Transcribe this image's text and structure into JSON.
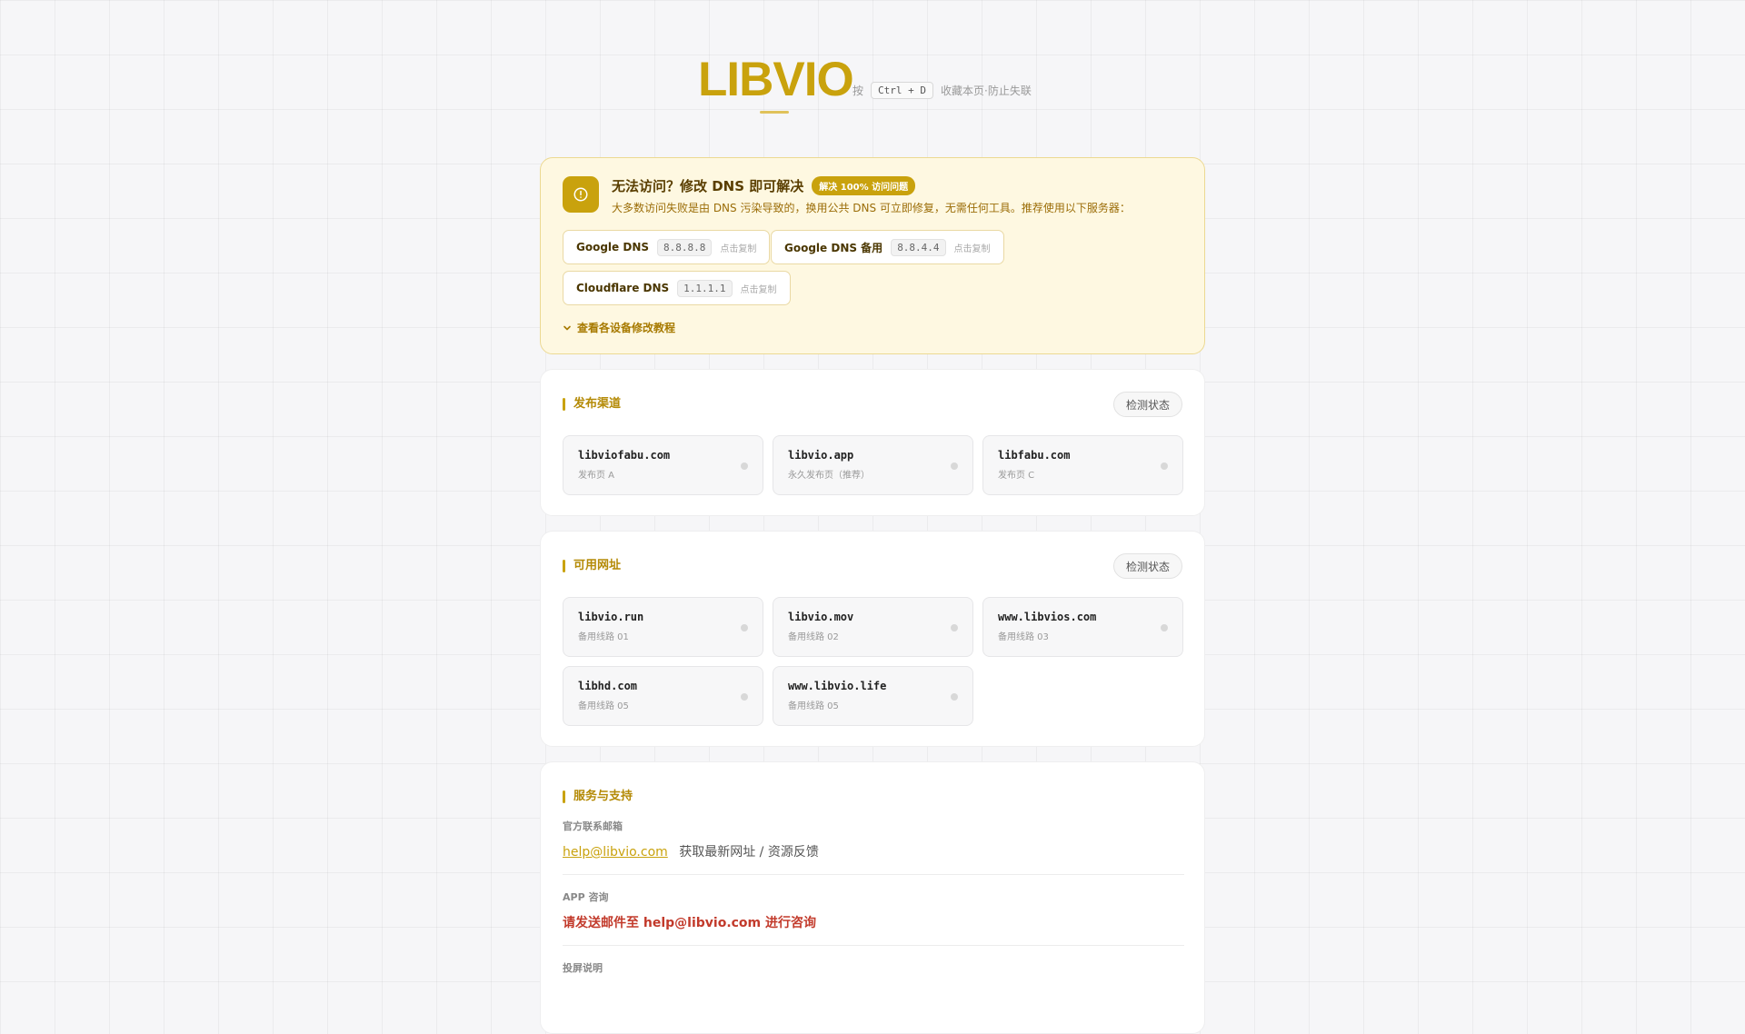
{
  "header": {
    "logo": "LIBVIO",
    "hint_prefix": "按",
    "shortcut": "Ctrl + D",
    "hint_suffix": "收藏本页·防止失联"
  },
  "dns": {
    "title": "无法访问？修改 DNS 即可解决",
    "badge": "解决 100% 访问问题",
    "description": "大多数访问失败是由 DNS 污染导致的，换用公共 DNS 可立即修复，无需任何工具。推荐使用以下服务器：",
    "copy_label": "点击复制",
    "servers": [
      {
        "name": "Google DNS",
        "ip": "8.8.8.8"
      },
      {
        "name": "Google DNS 备用",
        "ip": "8.8.4.4"
      },
      {
        "name": "Cloudflare DNS",
        "ip": "1.1.1.1"
      }
    ],
    "tutorial": "查看各设备修改教程",
    "icon": "alert-circle-icon"
  },
  "release": {
    "title": "发布渠道",
    "check_label": "检测状态",
    "items": [
      {
        "domain": "libviofabu.com",
        "desc": "发布页 A"
      },
      {
        "domain": "libvio.app",
        "desc": "永久发布页（推荐）"
      },
      {
        "domain": "libfabu.com",
        "desc": "发布页 C"
      }
    ]
  },
  "mirrors": {
    "title": "可用网址",
    "check_label": "检测状态",
    "items": [
      {
        "domain": "libvio.run",
        "desc": "备用线路 01"
      },
      {
        "domain": "libvio.mov",
        "desc": "备用线路 02"
      },
      {
        "domain": "www.libvios.com",
        "desc": "备用线路 03"
      },
      {
        "domain": "libhd.com",
        "desc": "备用线路 05"
      },
      {
        "domain": "www.libvio.life",
        "desc": "备用线路 05"
      }
    ]
  },
  "service": {
    "title": "服务与支持",
    "email_label": "官方联系邮箱",
    "email": "help@libvio.com",
    "email_note": "获取最新网址 / 资源反馈",
    "app_label": "APP 咨询",
    "app_text": "请发送邮件至 help@libvio.com 进行咨询",
    "cast_label": "投屏说明"
  },
  "colors": {
    "accent": "#c9a20d",
    "warning_bg": "#fef8e1",
    "danger": "#c23a2b"
  }
}
